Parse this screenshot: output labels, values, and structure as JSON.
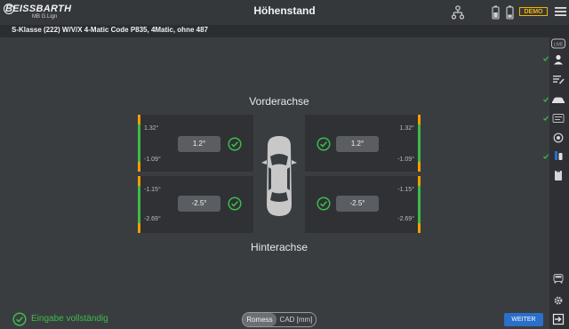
{
  "header": {
    "logo_text": "BEISSBARTH",
    "logo_subtext": "MB G.Lign",
    "title": "Höhenstand",
    "demo_label": "DEMO"
  },
  "vehicle": {
    "description": "S-Klasse (222) W/V/X 4-Matic Code P835, 4Matic, ohne 487"
  },
  "axles": {
    "front_label": "Vorderachse",
    "rear_label": "Hinterachse"
  },
  "wheels": {
    "front_left": {
      "max": "1.32°",
      "min": "-1.09°",
      "value": "1.2°"
    },
    "front_right": {
      "max": "1.32°",
      "min": "-1.09°",
      "value": "1.2°"
    },
    "rear_left": {
      "max": "-1.15°",
      "min": "-2.69°",
      "value": "-2.5°"
    },
    "rear_right": {
      "max": "-1.15°",
      "min": "-2.69°",
      "value": "-2.5°"
    }
  },
  "status": {
    "text": "Eingabe vollständig"
  },
  "unit_toggle": {
    "option_active": "Romess",
    "option_inactive": "CAD [mm]"
  },
  "actions": {
    "next_label": "WEITER"
  },
  "sidebar": {
    "live_label": "LIVE"
  },
  "colors": {
    "accent_green": "#3dbb4a",
    "limit_orange": "#f0a000",
    "demo_yellow": "#f0b400",
    "button_blue": "#2a6fc9"
  },
  "icons": {
    "menu": "hamburger-menu-icon",
    "network": "network-tree-icon",
    "battery": "battery-icon",
    "check": "check-circle-icon"
  }
}
